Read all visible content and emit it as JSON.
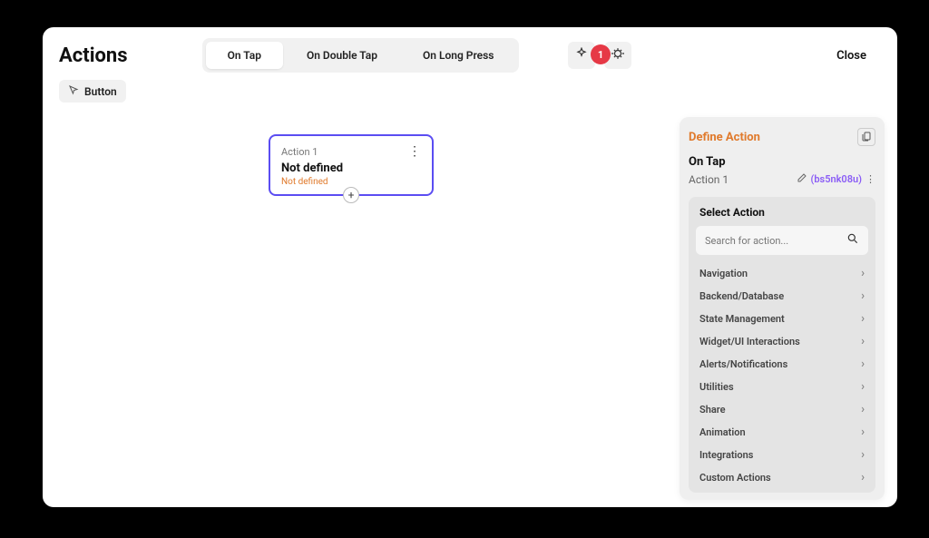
{
  "title": "Actions",
  "tabs": {
    "tap": "On Tap",
    "doubleTap": "On Double Tap",
    "longPress": "On Long Press"
  },
  "badge_count": "1",
  "close_label": "Close",
  "chip": {
    "label": "Button"
  },
  "card": {
    "num": "Action 1",
    "status": "Not defined",
    "sub": "Not defined"
  },
  "panel": {
    "title": "Define Action",
    "trigger": "On Tap",
    "action_name": "Action 1",
    "id_code": "(bs5nk08u)",
    "select_title": "Select Action",
    "search_placeholder": "Search for action...",
    "categories": [
      "Navigation",
      "Backend/Database",
      "State Management",
      "Widget/UI Interactions",
      "Alerts/Notifications",
      "Utilities",
      "Share",
      "Animation",
      "Integrations",
      "Custom Actions"
    ]
  }
}
